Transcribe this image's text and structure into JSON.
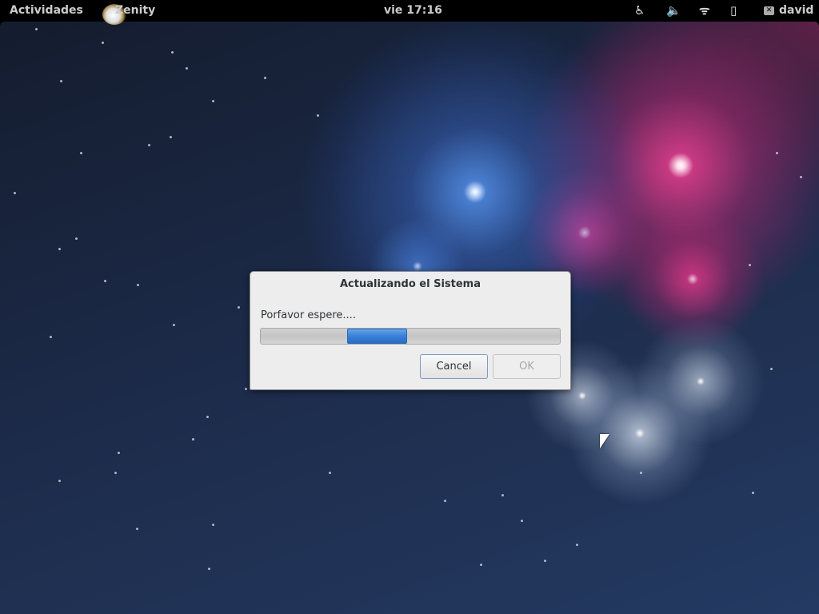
{
  "topbar": {
    "activities": "Actividades",
    "app_name": "Zenity",
    "clock": "vie 17:16",
    "user": "david",
    "icons": [
      "accessibility-icon",
      "volume-icon",
      "wifi-icon",
      "battery-icon",
      "chat-icon"
    ]
  },
  "dialog": {
    "title": "Actualizando el Sistema",
    "message": "Porfavor espere....",
    "progress": {
      "mode": "pulsing",
      "position_percent": [
        29,
        49
      ]
    },
    "cancel_label": "Cancel",
    "ok_label": "OK"
  }
}
